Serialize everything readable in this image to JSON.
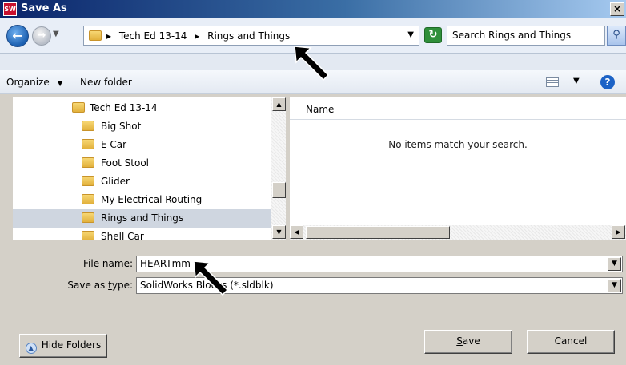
{
  "window": {
    "title": "Save As",
    "close_glyph": "×",
    "app_icon": "SW"
  },
  "address_bar": {
    "breadcrumbs": [
      "Tech Ed 13-14",
      "Rings and Things"
    ],
    "separator_glyph": "▸",
    "search_placeholder": "Search Rings and Things"
  },
  "toolbar": {
    "organize_label": "Organize",
    "new_folder_label": "New folder"
  },
  "folder_tree": {
    "items": [
      {
        "label": "Tech Ed 13-14",
        "level": 0,
        "selected": false
      },
      {
        "label": "Big Shot",
        "level": 1,
        "selected": false
      },
      {
        "label": "E Car",
        "level": 1,
        "selected": false
      },
      {
        "label": "Foot Stool",
        "level": 1,
        "selected": false
      },
      {
        "label": "Glider",
        "level": 1,
        "selected": false
      },
      {
        "label": "My Electrical Routing",
        "level": 1,
        "selected": false
      },
      {
        "label": "Rings and Things",
        "level": 1,
        "selected": true
      },
      {
        "label": "Shell Car",
        "level": 1,
        "selected": false
      }
    ]
  },
  "file_list": {
    "column_name": "Name",
    "empty_message": "No items match your search."
  },
  "form": {
    "file_name_label_pre": "File ",
    "file_name_label_ul": "n",
    "file_name_label_post": "ame:",
    "file_name_value": "HEARTmm",
    "save_type_label_pre": "Save as ",
    "save_type_label_ul": "t",
    "save_type_label_post": "ype:",
    "save_type_value": "SolidWorks Blocks (*.sldblk)"
  },
  "buttons": {
    "hide_folders": "Hide Folders",
    "save_ul": "S",
    "save_rest": "ave",
    "cancel": "Cancel"
  },
  "colors": {
    "titlebar": "#0a246a",
    "selection": "#cfd6e0",
    "face": "#d4d0c8"
  }
}
